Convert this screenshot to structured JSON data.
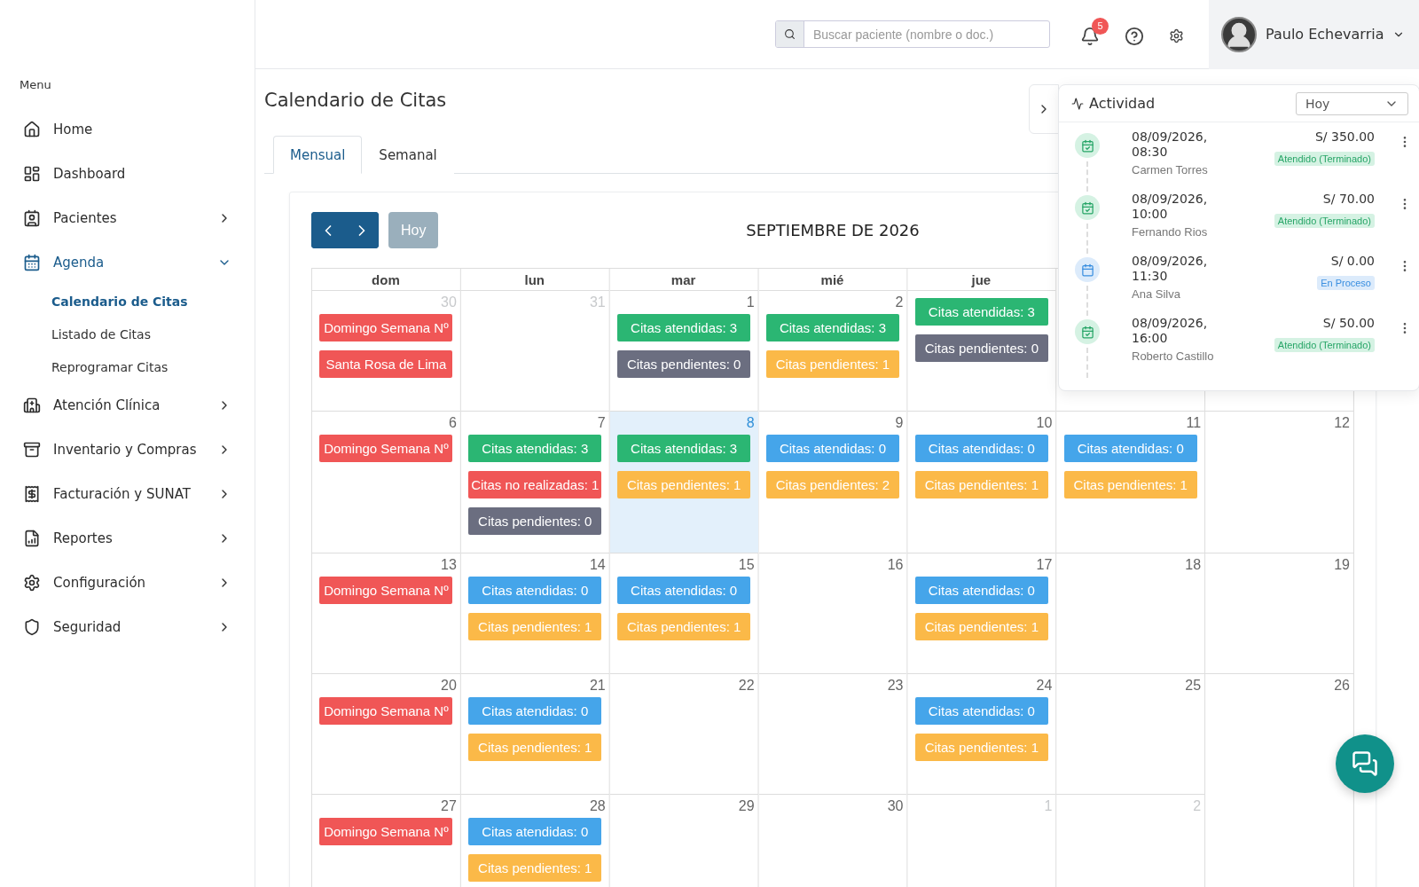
{
  "sidebar": {
    "heading": "Menu",
    "items": [
      {
        "label": "Home",
        "selected": false
      },
      {
        "label": "Dashboard",
        "selected": false
      },
      {
        "label": "Pacientes",
        "selected": false,
        "expanded": false
      },
      {
        "label": "Agenda",
        "selected": true,
        "expanded": true,
        "children": [
          {
            "label": "Calendario de Citas",
            "selected": true
          },
          {
            "label": "Listado de Citas",
            "selected": false
          },
          {
            "label": "Reprogramar Citas",
            "selected": false
          }
        ]
      },
      {
        "label": "Atención Clínica",
        "selected": false,
        "expanded": false
      },
      {
        "label": "Inventario y Compras",
        "selected": false,
        "expanded": false
      },
      {
        "label": "Facturación y SUNAT",
        "selected": false,
        "expanded": false
      },
      {
        "label": "Reportes",
        "selected": false,
        "expanded": false
      },
      {
        "label": "Configuración",
        "selected": false,
        "expanded": false
      },
      {
        "label": "Seguridad",
        "selected": false,
        "expanded": false
      }
    ]
  },
  "header": {
    "search": {
      "placeholder": "Buscar paciente (nombre o doc.)"
    },
    "notifications": "5",
    "user": "Paulo Echevarria"
  },
  "page_title": "Calendario de Citas",
  "tabs": [
    {
      "label": "Mensual",
      "selected": true
    },
    {
      "label": "Semanal",
      "selected": false
    }
  ],
  "calendar": {
    "today_button": {
      "label": "Hoy",
      "disabled": true
    },
    "month": "SEPTIEMBRE DE 2026",
    "weekdays": [
      "dom",
      "lun",
      "mar",
      "mié",
      "jue"
    ],
    "weeks": [
      {
        "days": [
          {
            "day": "30",
            "muted": true,
            "today": false,
            "events": [
              {
                "label": "Domingo Semana Nº",
                "color": "#f05656"
              },
              {
                "label": "Santa Rosa de Lima",
                "color": "#f05656"
              }
            ]
          },
          {
            "day": "31",
            "muted": true,
            "today": false
          },
          {
            "day": "1",
            "muted": false,
            "today": false,
            "events": [
              {
                "label": "Citas atendidas: 3",
                "color": "#2bb673"
              },
              {
                "label": "Citas pendientes: 0",
                "color": "#6b6e80"
              }
            ]
          },
          {
            "day": "2",
            "muted": false,
            "today": false,
            "events": [
              {
                "label": "Citas atendidas: 3",
                "color": "#2bb673"
              },
              {
                "label": "Citas pendientes: 1",
                "color": "#fbb948"
              }
            ]
          },
          {
            "today": false,
            "events": [
              {
                "label": "Citas atendidas: 3",
                "color": "#2bb673"
              },
              {
                "label": "Citas pendientes: 0",
                "color": "#6b6e80"
              }
            ]
          }
        ]
      },
      {
        "days": [
          {
            "day": "6",
            "muted": false,
            "today": false,
            "events": [
              {
                "label": "Domingo Semana Nº",
                "color": "#f05656"
              }
            ]
          },
          {
            "day": "7",
            "muted": false,
            "today": false,
            "events": [
              {
                "label": "Citas atendidas: 3",
                "color": "#2bb673"
              },
              {
                "label": "Citas no realizadas: 1",
                "color": "#f05656"
              },
              {
                "label": "Citas pendientes: 0",
                "color": "#6b6e80"
              }
            ]
          },
          {
            "day": "8",
            "muted": false,
            "today": true,
            "events": [
              {
                "label": "Citas atendidas: 3",
                "color": "#2bb673"
              },
              {
                "label": "Citas pendientes: 1",
                "color": "#fbb948"
              }
            ]
          },
          {
            "day": "9",
            "muted": false,
            "today": false,
            "events": [
              {
                "label": "Citas atendidas: 0",
                "color": "#45a5ea"
              },
              {
                "label": "Citas pendientes: 2",
                "color": "#fbb948"
              }
            ]
          },
          {
            "day": "10",
            "muted": false,
            "today": false,
            "events": [
              {
                "label": "Citas atendidas: 0",
                "color": "#45a5ea"
              },
              {
                "label": "Citas pendientes: 1",
                "color": "#fbb948"
              }
            ]
          },
          {
            "day": "11",
            "muted": false,
            "today": false,
            "events": [
              {
                "label": "Citas atendidas: 0",
                "color": "#45a5ea"
              },
              {
                "label": "Citas pendientes: 1",
                "color": "#fbb948"
              }
            ]
          },
          {
            "day": "12",
            "muted": false,
            "today": false
          }
        ]
      },
      {
        "days": [
          {
            "day": "13",
            "muted": false,
            "today": false,
            "events": [
              {
                "label": "Domingo Semana Nº",
                "color": "#f05656"
              }
            ]
          },
          {
            "day": "14",
            "muted": false,
            "today": false,
            "events": [
              {
                "label": "Citas atendidas: 0",
                "color": "#45a5ea"
              },
              {
                "label": "Citas pendientes: 1",
                "color": "#fbb948"
              }
            ]
          },
          {
            "day": "15",
            "muted": false,
            "today": false,
            "events": [
              {
                "label": "Citas atendidas: 0",
                "color": "#45a5ea"
              },
              {
                "label": "Citas pendientes: 1",
                "color": "#fbb948"
              }
            ]
          },
          {
            "day": "16",
            "muted": false,
            "today": false
          },
          {
            "day": "17",
            "muted": false,
            "today": false,
            "events": [
              {
                "label": "Citas atendidas: 0",
                "color": "#45a5ea"
              },
              {
                "label": "Citas pendientes: 1",
                "color": "#fbb948"
              }
            ]
          },
          {
            "day": "18",
            "muted": false,
            "today": false
          },
          {
            "day": "19",
            "muted": false,
            "today": false
          }
        ]
      },
      {
        "days": [
          {
            "day": "20",
            "muted": false,
            "today": false,
            "events": [
              {
                "label": "Domingo Semana Nº",
                "color": "#f05656"
              }
            ]
          },
          {
            "day": "21",
            "muted": false,
            "today": false,
            "events": [
              {
                "label": "Citas atendidas: 0",
                "color": "#45a5ea"
              },
              {
                "label": "Citas pendientes: 1",
                "color": "#fbb948"
              }
            ]
          },
          {
            "day": "22",
            "muted": false,
            "today": false
          },
          {
            "day": "23",
            "muted": false,
            "today": false
          },
          {
            "day": "24",
            "muted": false,
            "today": false,
            "events": [
              {
                "label": "Citas atendidas: 0",
                "color": "#45a5ea"
              },
              {
                "label": "Citas pendientes: 1",
                "color": "#fbb948"
              }
            ]
          },
          {
            "day": "25",
            "muted": false,
            "today": false
          },
          {
            "day": "26",
            "muted": false,
            "today": false
          }
        ]
      },
      {
        "days": [
          {
            "day": "27",
            "muted": false,
            "today": false,
            "events": [
              {
                "label": "Domingo Semana Nº",
                "color": "#f05656"
              }
            ]
          },
          {
            "day": "28",
            "muted": false,
            "today": false,
            "events": [
              {
                "label": "Citas atendidas: 0",
                "color": "#45a5ea"
              },
              {
                "label": "Citas pendientes: 1",
                "color": "#fbb948"
              }
            ]
          },
          {
            "day": "29",
            "muted": false,
            "today": false
          },
          {
            "day": "30",
            "muted": false,
            "today": false
          },
          {
            "day": "1",
            "muted": true,
            "today": false
          },
          {
            "day": "2",
            "muted": true,
            "today": false
          }
        ]
      }
    ]
  },
  "activity": {
    "title": "Actividad",
    "filter": "Hoy",
    "items": [
      {
        "date": "08/09/2026, 08:30",
        "patient": "Carmen Torres",
        "amount": "S/ 350.00",
        "status": "Atendido (Terminado)",
        "kind": "done"
      },
      {
        "date": "08/09/2026, 10:00",
        "patient": "Fernando Rios",
        "amount": "S/ 70.00",
        "status": "Atendido (Terminado)",
        "kind": "done"
      },
      {
        "date": "08/09/2026, 11:30",
        "patient": "Ana Silva",
        "amount": "S/ 0.00",
        "status": "En Proceso",
        "kind": "progress"
      },
      {
        "date": "08/09/2026, 16:00",
        "patient": "Roberto Castillo",
        "amount": "S/ 50.00",
        "status": "Atendido (Terminado)",
        "kind": "done"
      }
    ]
  }
}
